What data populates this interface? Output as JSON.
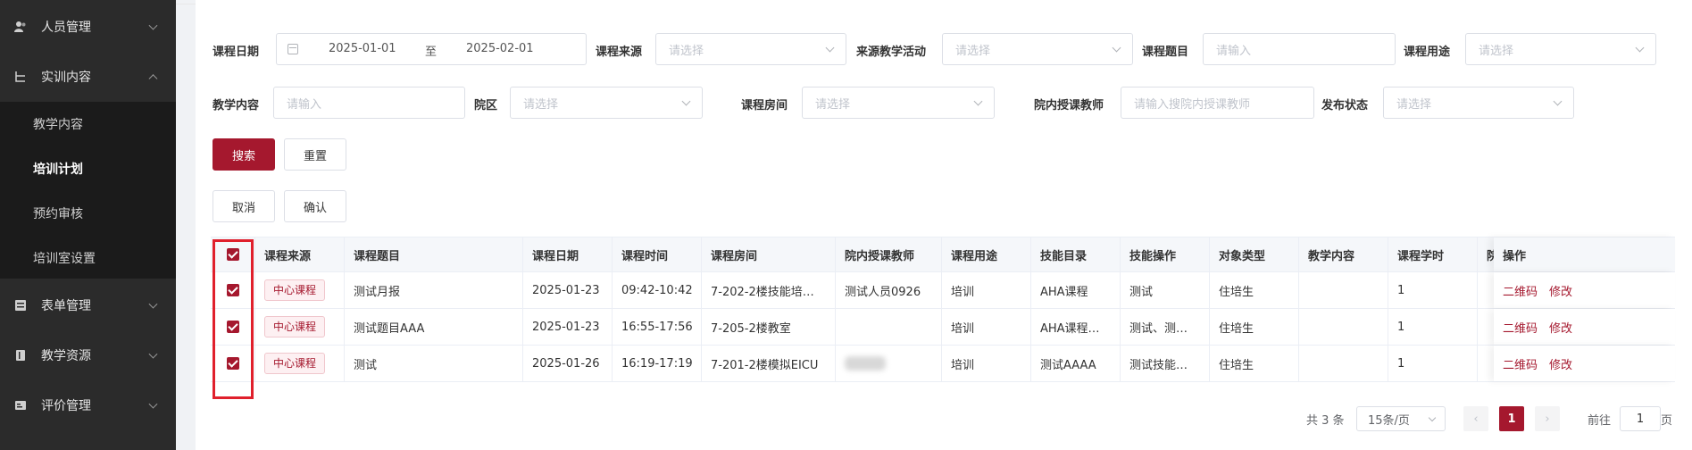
{
  "sidebar": {
    "items": [
      {
        "label": "人员管理",
        "icon": "users-icon"
      },
      {
        "label": "实训内容",
        "icon": "tree-icon"
      },
      {
        "label": "表单管理",
        "icon": "form-icon"
      },
      {
        "label": "教学资源",
        "icon": "book-icon"
      },
      {
        "label": "评价管理",
        "icon": "evaluation-icon"
      }
    ],
    "submenu": [
      "教学内容",
      "培训计划",
      "预约审核",
      "培训室设置"
    ]
  },
  "filters": {
    "date_label": "课程日期",
    "date_start": "2025-01-01",
    "date_sep": "至",
    "date_end": "2025-02-01",
    "source_label": "课程来源",
    "source_placeholder": "请选择",
    "activity_label": "来源教学活动",
    "activity_placeholder": "请选择",
    "topic_label": "课程题目",
    "topic_placeholder": "请输入",
    "usage_label": "课程用途",
    "usage_placeholder": "请选择",
    "content_label": "教学内容",
    "content_placeholder": "请输入",
    "campus_label": "院区",
    "campus_placeholder": "请选择",
    "room_label": "课程房间",
    "room_placeholder": "请选择",
    "teacher_label": "院内授课教师",
    "teacher_placeholder": "请输入搜院内授课教师",
    "status_label": "发布状态",
    "status_placeholder": "请选择"
  },
  "buttons": {
    "search": "搜索",
    "reset": "重置",
    "cancel": "取消",
    "confirm": "确认"
  },
  "table": {
    "headers": [
      "课程来源",
      "课程题目",
      "课程日期",
      "课程时间",
      "课程房间",
      "院内授课教师",
      "课程用途",
      "技能目录",
      "技能操作",
      "对象类型",
      "教学内容",
      "课程学时",
      "院",
      "操作"
    ],
    "rows": [
      {
        "source": "中心课程",
        "topic": "测试月报",
        "date": "2025-01-23",
        "time": "09:42-10:42",
        "room": "7-202-2楼技能培…",
        "teacher": "测试人员0926",
        "usage": "培训",
        "skill_dir": "AHA课程",
        "skill_op": "测试",
        "target": "住培生",
        "content": "",
        "hours": "1"
      },
      {
        "source": "中心课程",
        "topic": "测试题目AAA",
        "date": "2025-01-23",
        "time": "16:55-17:56",
        "room": "7-205-2楼教室",
        "teacher": "",
        "usage": "培训",
        "skill_dir": "AHA课程…",
        "skill_op": "测试、测…",
        "target": "住培生",
        "content": "",
        "hours": "1"
      },
      {
        "source": "中心课程",
        "topic": "测试",
        "date": "2025-01-26",
        "time": "16:19-17:19",
        "room": "7-201-2楼模拟EICU",
        "teacher": "",
        "usage": "培训",
        "skill_dir": "测试AAAA",
        "skill_op": "测试技能…",
        "target": "住培生",
        "content": "",
        "hours": "1"
      }
    ],
    "op_qrcode": "二维码",
    "op_edit": "修改"
  },
  "pagination": {
    "total": "共 3 条",
    "page_size": "15条/页",
    "current": "1",
    "goto_prefix": "前往",
    "goto_value": "1",
    "goto_suffix": "页"
  },
  "colors": {
    "accent": "#a5182e",
    "sidebar": "#2b2b2b",
    "highlight": "#e0202c"
  }
}
